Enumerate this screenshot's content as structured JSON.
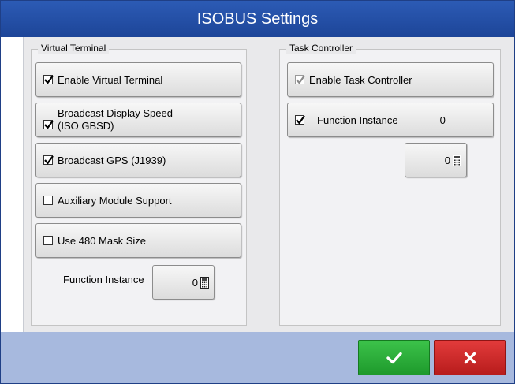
{
  "window": {
    "title": "ISOBUS Settings"
  },
  "virtual_terminal": {
    "label": "Virtual Terminal",
    "options": [
      {
        "label": "Enable Virtual Terminal",
        "checked": true
      },
      {
        "label_line1": "Broadcast Display Speed",
        "label_line2": "(ISO GBSD)",
        "checked": true
      },
      {
        "label": "Broadcast GPS (J1939)",
        "checked": true
      },
      {
        "label": "Auxiliary Module Support",
        "checked": false
      },
      {
        "label": "Use 480 Mask Size",
        "checked": false
      }
    ],
    "function_instance_label": "Function Instance",
    "function_instance_value": "0"
  },
  "task_controller": {
    "label": "Task Controller",
    "enable": {
      "label": "Enable Task Controller",
      "checked": true,
      "disabled": true
    },
    "function_instance": {
      "label": "Function Instance",
      "value": "0",
      "checked": true
    },
    "function_instance_value": "0"
  },
  "icons": {
    "check": "check-icon",
    "close": "close-icon",
    "calculator": "calculator-icon"
  },
  "colors": {
    "title_bar": "#2355ad",
    "ok": "#2aaa3a",
    "cancel": "#d32a2a",
    "footer": "#a7b9de"
  }
}
